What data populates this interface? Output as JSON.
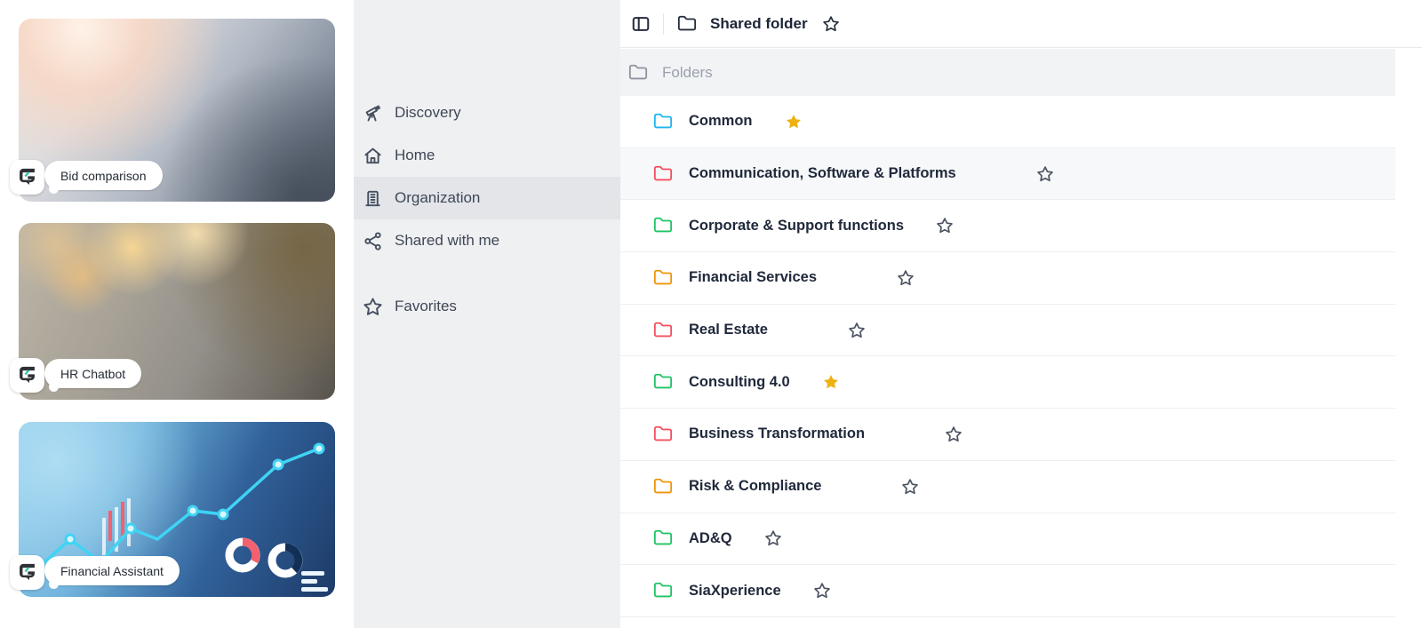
{
  "apps": {
    "items": [
      {
        "label": "Bid comparison",
        "image": "bid-documents-photo",
        "badge_icon": "g-logo-icon"
      },
      {
        "label": "HR Chatbot",
        "image": "phone-hands-photo",
        "badge_icon": "g-logo-icon"
      },
      {
        "label": "Financial Assistant",
        "image": "finance-tablet-photo",
        "badge_icon": "g-logo-icon"
      }
    ]
  },
  "sidebar": {
    "items": [
      {
        "label": "Discovery",
        "icon": "telescope-icon",
        "selected": false
      },
      {
        "label": "Home",
        "icon": "home-icon",
        "selected": false
      },
      {
        "label": "Organization",
        "icon": "building-icon",
        "selected": true
      },
      {
        "label": "Shared with me",
        "icon": "share-icon",
        "selected": false
      },
      {
        "label": "Favorites",
        "icon": "star-icon",
        "selected": false,
        "chevron": true,
        "spaced": true
      }
    ]
  },
  "main": {
    "header": {
      "title": "Shared folder",
      "toggle_icon": "panel-left-icon",
      "folder_icon": "folder-icon",
      "star_icon": "star-icon"
    },
    "section_header": {
      "label": "Folders",
      "icon": "folder-icon"
    },
    "folders": [
      {
        "name": "Common",
        "color": "cyan",
        "starred": true,
        "highlighted": false
      },
      {
        "name": "Communication, Software & Platforms",
        "color": "red",
        "starred": false,
        "highlighted": true
      },
      {
        "name": "Corporate & Support functions",
        "color": "green",
        "starred": false,
        "highlighted": false
      },
      {
        "name": "Financial Services",
        "color": "orange",
        "starred": false,
        "highlighted": false
      },
      {
        "name": "Real Estate",
        "color": "red",
        "starred": false,
        "highlighted": false
      },
      {
        "name": "Consulting 4.0",
        "color": "green",
        "starred": true,
        "highlighted": false
      },
      {
        "name": "Business Transformation",
        "color": "red",
        "starred": false,
        "highlighted": false
      },
      {
        "name": "Risk & Compliance",
        "color": "orange",
        "starred": false,
        "highlighted": false
      },
      {
        "name": "AD&Q",
        "color": "green",
        "starred": false,
        "highlighted": false
      },
      {
        "name": "SiaXperience",
        "color": "green",
        "starred": false,
        "highlighted": false
      }
    ]
  },
  "colors": {
    "folder_cyan": "#1fb6f0",
    "folder_red": "#f44f5e",
    "folder_green": "#1ec463",
    "folder_orange": "#f0940a",
    "star_filled": "#edb111",
    "star_outline": "#4a5260",
    "sidebar_bg": "#eff0f2",
    "selected_item_bg": "#e3e5e9",
    "row_highlight_bg": "#f7f8f9",
    "logo_dark": "#2f3136",
    "logo_teal": "#27c3a0"
  }
}
